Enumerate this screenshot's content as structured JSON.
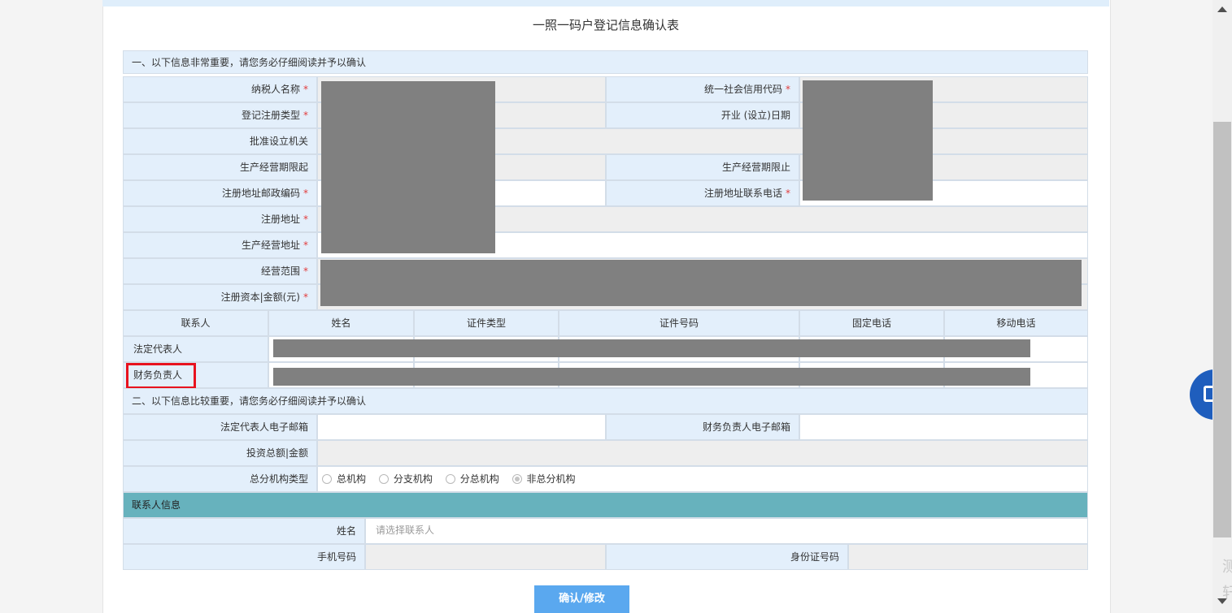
{
  "page": {
    "title": "一照一码户登记信息确认表"
  },
  "section1": {
    "title": "一、以下信息非常重要，请您务必仔细阅读并予以确认",
    "fields": {
      "taxpayer_name": "纳税人名称",
      "credit_code": "统一社会信用代码",
      "reg_type": "登记注册类型",
      "open_date": "开业 (设立)日期",
      "approval_org": "批准设立机关",
      "period_start": "生产经营期限起",
      "period_end": "生产经营期限止",
      "reg_postcode": "注册地址邮政编码",
      "reg_phone": "注册地址联系电话",
      "reg_address": "注册地址",
      "biz_address": "生产经营地址",
      "biz_scope": "经营范围",
      "reg_capital": "注册资本|金额(元)"
    },
    "required_mark": "*",
    "contacts": {
      "headers": [
        "联系人",
        "姓名",
        "证件类型",
        "证件号码",
        "固定电话",
        "移动电话"
      ],
      "rows": [
        "法定代表人",
        "财务负责人"
      ]
    }
  },
  "section2": {
    "title": "二、以下信息比较重要，请您务必仔细阅读并予以确认",
    "fields": {
      "legal_email": "法定代表人电子邮箱",
      "finance_email": "财务负责人电子邮箱",
      "investment_total": "投资总额|金额",
      "branch_type": "总分机构类型"
    },
    "branch_options": [
      "总机构",
      "分支机构",
      "分总机构",
      "非总分机构"
    ],
    "branch_selected": "非总分机构"
  },
  "contact_info": {
    "title": "联系人信息",
    "name_label": "姓名",
    "name_placeholder": "请选择联系人",
    "mobile_label": "手机号码",
    "id_label": "身份证号码"
  },
  "actions": {
    "confirm": "确认/修改"
  },
  "side_text": [
    "测",
    "轩"
  ],
  "colors": {
    "header_bg": "#e3effb",
    "contact_header_bg": "#67b2bd",
    "button_bg": "#5aa8ef",
    "highlight": "#e8121e"
  }
}
